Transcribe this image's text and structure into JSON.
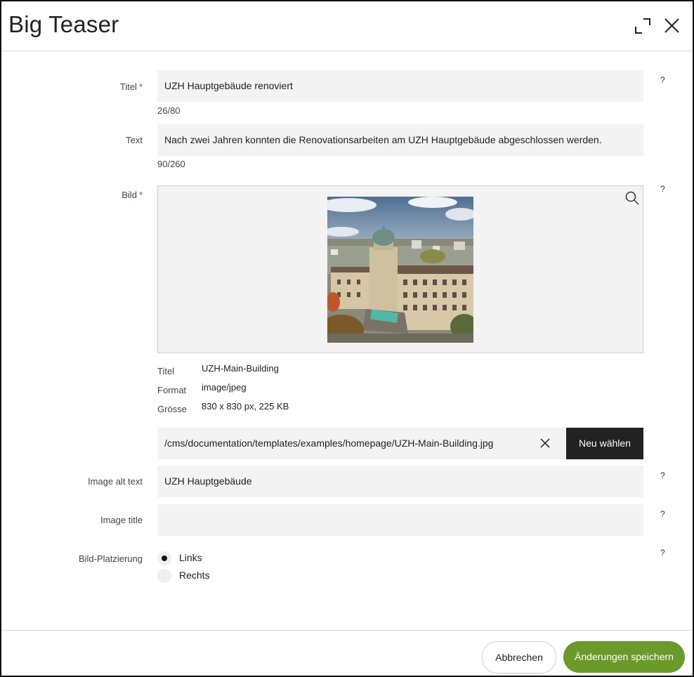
{
  "dialog": {
    "title": "Big Teaser",
    "expand_icon": "expand-icon",
    "close_icon": "close-icon"
  },
  "fields": {
    "titel": {
      "label": "Titel",
      "required_mark": "*",
      "value": "UZH Hauptgebäude renoviert",
      "counter": "26/80",
      "help": "?"
    },
    "text": {
      "label": "Text",
      "value": "Nach zwei Jahren konnten die Renovationsarbeiten am UZH Hauptgebäude abgeschlossen werden.",
      "counter": "90/260"
    },
    "bild": {
      "label": "Bild",
      "required_mark": "*",
      "help": "?",
      "zoom_icon": "search-icon",
      "meta": [
        {
          "key": "Titel",
          "value": "UZH-Main-Building"
        },
        {
          "key": "Format",
          "value": "image/jpeg"
        },
        {
          "key": "Grösse",
          "value": "830 x 830 px, 225 KB"
        }
      ],
      "path": "/cms/documentation/templates/examples/homepage/UZH-Main-Building.jpg",
      "choose_label": "Neu wählen"
    },
    "alt_text": {
      "label": "Image alt text",
      "value": "UZH Hauptgebäude",
      "help": "?"
    },
    "image_title": {
      "label": "Image title",
      "value": "",
      "help": "?"
    },
    "placement": {
      "label": "Bild-Platzierung",
      "help": "?",
      "options": [
        "Links",
        "Rechts"
      ],
      "selected": "Links"
    }
  },
  "footer": {
    "cancel_label": "Abbrechen",
    "save_label": "Änderungen speichern"
  },
  "colors": {
    "accent": "#6a9a2a",
    "dark_button": "#222222",
    "required": "#dd3333"
  }
}
